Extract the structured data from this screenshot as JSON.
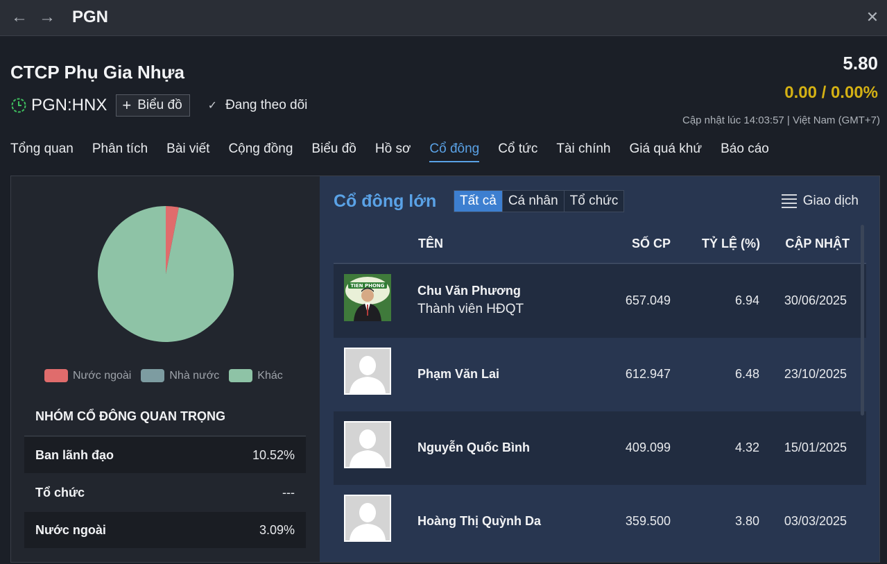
{
  "window": {
    "title": "PGN"
  },
  "company": {
    "name": "CTCP Phụ Gia Nhựa",
    "ticker": "PGN:HNX",
    "chart_button": "Biểu đồ",
    "follow_label": "Đang theo dõi"
  },
  "quote": {
    "price": "5.80",
    "change": "0.00 / 0.00%",
    "updated": "Cập nhật lúc  14:03:57 | Việt Nam (GMT+7)"
  },
  "tabs": [
    {
      "label": "Tổng quan"
    },
    {
      "label": "Phân tích"
    },
    {
      "label": "Bài viết"
    },
    {
      "label": "Cộng đồng"
    },
    {
      "label": "Biểu đồ"
    },
    {
      "label": "Hồ sơ"
    },
    {
      "label": "Cổ đông"
    },
    {
      "label": "Cổ tức"
    },
    {
      "label": "Tài chính"
    },
    {
      "label": "Giá quá khứ"
    },
    {
      "label": "Báo cáo"
    }
  ],
  "active_tab": "Cổ đông",
  "ownership_pie": {
    "slices": [
      {
        "name": "Nước ngoài",
        "value": 3.09,
        "color": "#e06c6c"
      },
      {
        "name": "Nhà nước",
        "value": 0,
        "color": "#7d9ca1"
      },
      {
        "name": "Khác",
        "value": 96.91,
        "color": "#8ec3a6"
      }
    ]
  },
  "key_groups": {
    "title": "NHÓM CỔ ĐÔNG QUAN TRỌNG",
    "rows": [
      {
        "label": "Ban lãnh đạo",
        "value": "10.52%"
      },
      {
        "label": "Tổ chức",
        "value": "---"
      },
      {
        "label": "Nước ngoài",
        "value": "3.09%"
      }
    ]
  },
  "shareholders": {
    "title": "Cổ đông lớn",
    "filters": [
      "Tất cả",
      "Cá nhân",
      "Tổ chức"
    ],
    "active_filter": "Tất cả",
    "transactions_label": "Giao dịch",
    "columns": [
      "TÊN",
      "SỐ CP",
      "TỶ LỆ (%)",
      "CẬP NHẬT"
    ],
    "rows": [
      {
        "name": "Chu Văn Phương",
        "role": "Thành viên HĐQT",
        "shares": "657.049",
        "pct": "6.94",
        "date": "30/06/2025",
        "photo": true
      },
      {
        "name": "Phạm Văn Lai",
        "role": "",
        "shares": "612.947",
        "pct": "6.48",
        "date": "23/10/2025",
        "photo": false
      },
      {
        "name": "Nguyễn Quốc Bình",
        "role": "",
        "shares": "409.099",
        "pct": "4.32",
        "date": "15/01/2025",
        "photo": false
      },
      {
        "name": "Hoàng Thị Quỳnh Da",
        "role": "",
        "shares": "359.500",
        "pct": "3.80",
        "date": "03/03/2025",
        "photo": false
      }
    ]
  }
}
